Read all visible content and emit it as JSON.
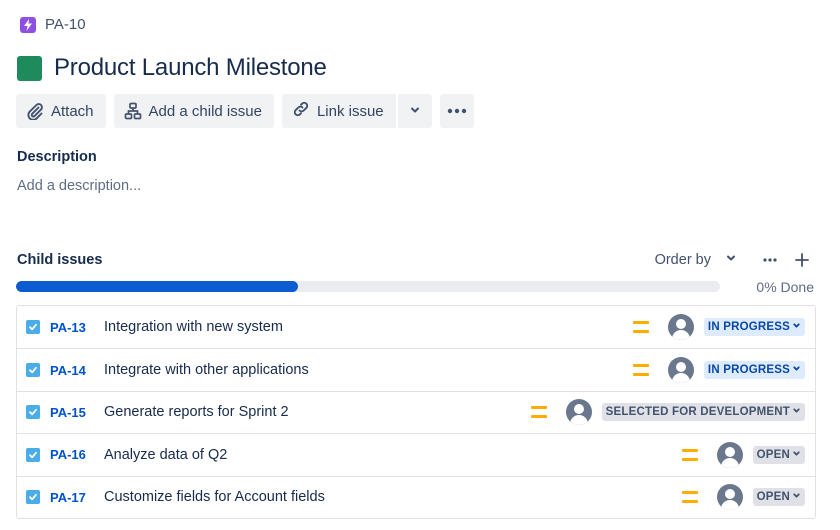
{
  "breadcrumb": {
    "issue_key": "PA-10",
    "icon": "epic-lightning-icon"
  },
  "header": {
    "title": "Product Launch Milestone",
    "swatch_color": "#1f8a5b"
  },
  "toolbar": {
    "attach_label": "Attach",
    "add_child_label": "Add a child issue",
    "link_issue_label": "Link issue"
  },
  "description": {
    "heading": "Description",
    "placeholder": "Add a description..."
  },
  "child_issues": {
    "heading": "Child issues",
    "order_by_label": "Order by",
    "progress_fraction": 0.4,
    "done_label": "0% Done",
    "items": [
      {
        "key": "PA-13",
        "summary": "Integration with new system",
        "priority": "medium",
        "status": "IN PROGRESS",
        "status_type": "in-progress"
      },
      {
        "key": "PA-14",
        "summary": "Integrate with other applications",
        "priority": "medium",
        "status": "IN PROGRESS",
        "status_type": "in-progress"
      },
      {
        "key": "PA-15",
        "summary": "Generate reports for Sprint 2",
        "priority": "medium",
        "status": "SELECTED FOR DEVELOPMENT",
        "status_type": "neutral"
      },
      {
        "key": "PA-16",
        "summary": "Analyze data of Q2",
        "priority": "medium",
        "status": "OPEN",
        "status_type": "neutral"
      },
      {
        "key": "PA-17",
        "summary": "Customize fields for Account fields",
        "priority": "medium",
        "status": "OPEN",
        "status_type": "neutral"
      }
    ]
  },
  "colors": {
    "accent_blue": "#0c5bd1",
    "epic_purple": "#904ee2",
    "priority_medium": "#ffab00",
    "checkbox_blue": "#4bade8"
  }
}
